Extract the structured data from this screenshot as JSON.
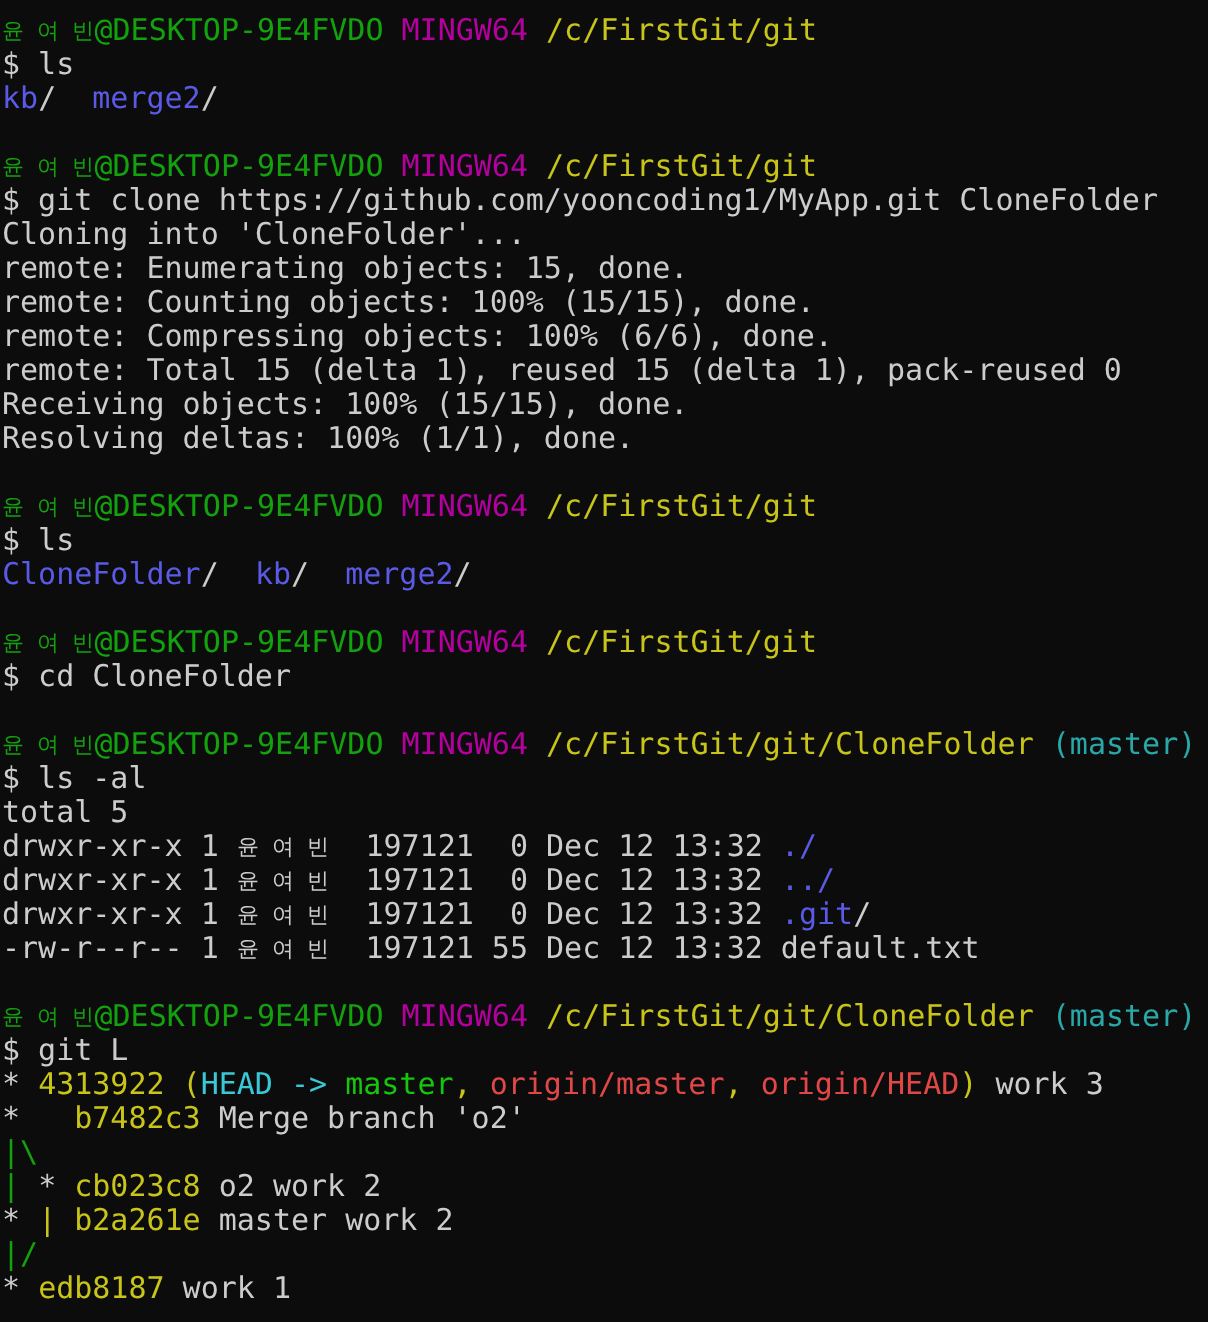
{
  "terminal": {
    "blocks": [
      {
        "prompt": {
          "user": "윤 여 빈",
          "host": "@DESKTOP-9E4FVDO",
          "shell": "MINGW64",
          "path": "/c/FirstGit/git"
        },
        "command": "$ ls",
        "output": [
          [
            {
              "kind": "dir",
              "text": "kb"
            },
            {
              "kind": "text",
              "text": "/  "
            },
            {
              "kind": "dir",
              "text": "merge2"
            },
            {
              "kind": "text",
              "text": "/"
            }
          ]
        ]
      },
      {
        "prompt": {
          "user": "윤 여 빈",
          "host": "@DESKTOP-9E4FVDO",
          "shell": "MINGW64",
          "path": "/c/FirstGit/git"
        },
        "command": "$ git clone https://github.com/yooncoding1/MyApp.git CloneFolder",
        "output": [
          [
            {
              "kind": "text",
              "text": "Cloning into 'CloneFolder'..."
            }
          ],
          [
            {
              "kind": "text",
              "text": "remote: Enumerating objects: 15, done."
            }
          ],
          [
            {
              "kind": "text",
              "text": "remote: Counting objects: 100% (15/15), done."
            }
          ],
          [
            {
              "kind": "text",
              "text": "remote: Compressing objects: 100% (6/6), done."
            }
          ],
          [
            {
              "kind": "text",
              "text": "remote: Total 15 (delta 1), reused 15 (delta 1), pack-reused 0"
            }
          ],
          [
            {
              "kind": "text",
              "text": "Receiving objects: 100% (15/15), done."
            }
          ],
          [
            {
              "kind": "text",
              "text": "Resolving deltas: 100% (1/1), done."
            }
          ]
        ]
      },
      {
        "prompt": {
          "user": "윤 여 빈",
          "host": "@DESKTOP-9E4FVDO",
          "shell": "MINGW64",
          "path": "/c/FirstGit/git"
        },
        "command": "$ ls",
        "output": [
          [
            {
              "kind": "dir",
              "text": "CloneFolder"
            },
            {
              "kind": "text",
              "text": "/  "
            },
            {
              "kind": "dir",
              "text": "kb"
            },
            {
              "kind": "text",
              "text": "/  "
            },
            {
              "kind": "dir",
              "text": "merge2"
            },
            {
              "kind": "text",
              "text": "/"
            }
          ]
        ]
      },
      {
        "prompt": {
          "user": "윤 여 빈",
          "host": "@DESKTOP-9E4FVDO",
          "shell": "MINGW64",
          "path": "/c/FirstGit/git"
        },
        "command": "$ cd CloneFolder"
      },
      {
        "prompt": {
          "user": "윤 여 빈",
          "host": "@DESKTOP-9E4FVDO",
          "shell": "MINGW64",
          "path": "/c/FirstGit/git/CloneFolder",
          "branch": "(master)"
        },
        "command": "$ ls -al",
        "output": [
          [
            {
              "kind": "text",
              "text": "total 5"
            }
          ],
          [
            {
              "kind": "text",
              "text": "drwxr-xr-x 1 "
            },
            {
              "kind": "owner",
              "text": "윤 여 빈"
            },
            {
              "kind": "text",
              "text": "  197121  0 Dec 12 13:32 "
            },
            {
              "kind": "dir",
              "text": "./"
            }
          ],
          [
            {
              "kind": "text",
              "text": "drwxr-xr-x 1 "
            },
            {
              "kind": "owner",
              "text": "윤 여 빈"
            },
            {
              "kind": "text",
              "text": "  197121  0 Dec 12 13:32 "
            },
            {
              "kind": "dir",
              "text": "../"
            }
          ],
          [
            {
              "kind": "text",
              "text": "drwxr-xr-x 1 "
            },
            {
              "kind": "owner",
              "text": "윤 여 빈"
            },
            {
              "kind": "text",
              "text": "  197121  0 Dec 12 13:32 "
            },
            {
              "kind": "dir",
              "text": ".git"
            },
            {
              "kind": "text",
              "text": "/"
            }
          ],
          [
            {
              "kind": "text",
              "text": "-rw-r--r-- 1 "
            },
            {
              "kind": "owner",
              "text": "윤 여 빈"
            },
            {
              "kind": "text",
              "text": "  197121 55 Dec 12 13:32 default.txt"
            }
          ]
        ]
      },
      {
        "prompt": {
          "user": "윤 여 빈",
          "host": "@DESKTOP-9E4FVDO",
          "shell": "MINGW64",
          "path": "/c/FirstGit/git/CloneFolder",
          "branch": "(master)"
        },
        "command": "$ git L",
        "output": [
          [
            {
              "kind": "graph",
              "text": "* "
            },
            {
              "kind": "hash",
              "text": "4313922 ("
            },
            {
              "kind": "head",
              "text": "HEAD -> "
            },
            {
              "kind": "local",
              "text": "master"
            },
            {
              "kind": "hash",
              "text": ", "
            },
            {
              "kind": "remote",
              "text": "origin/master"
            },
            {
              "kind": "hash",
              "text": ", "
            },
            {
              "kind": "remote",
              "text": "origin/HEAD"
            },
            {
              "kind": "hash",
              "text": ")"
            },
            {
              "kind": "text",
              "text": " work 3"
            }
          ],
          [
            {
              "kind": "graph",
              "text": "*   "
            },
            {
              "kind": "hash",
              "text": "b7482c3"
            },
            {
              "kind": "text",
              "text": " Merge branch 'o2'"
            }
          ],
          [
            {
              "kind": "branchline",
              "text": "|\\"
            }
          ],
          [
            {
              "kind": "branchline",
              "text": "| "
            },
            {
              "kind": "graph",
              "text": "* "
            },
            {
              "kind": "hash",
              "text": "cb023c8"
            },
            {
              "kind": "text",
              "text": " o2 work 2"
            }
          ],
          [
            {
              "kind": "graph",
              "text": "* "
            },
            {
              "kind": "hash",
              "text": "| b2a261e"
            },
            {
              "kind": "text",
              "text": " master work 2"
            }
          ],
          [
            {
              "kind": "branchline",
              "text": "|/"
            }
          ],
          [
            {
              "kind": "graph",
              "text": "* "
            },
            {
              "kind": "hash",
              "text": "edb8187"
            },
            {
              "kind": "text",
              "text": " work 1"
            }
          ]
        ]
      }
    ]
  }
}
